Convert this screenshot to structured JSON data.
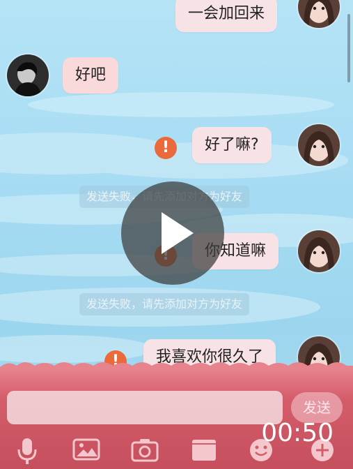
{
  "messages": [
    {
      "text": "一会加回来"
    },
    {
      "text": "好吧"
    },
    {
      "text": "好了嘛?"
    },
    {
      "text": "你知道嘛"
    },
    {
      "text": "我喜欢你很久了"
    }
  ],
  "notices": [
    {
      "text": "发送失败，请先添加对方为好友"
    },
    {
      "text": "发送失败，请先添加对方为好友"
    }
  ],
  "input_bar": {
    "placeholder": "",
    "send_label": "发送"
  },
  "video": {
    "time": "00:50"
  },
  "toolbar": [
    "microphone-icon",
    "image-icon",
    "camera-icon",
    "folder-icon",
    "emoji-icon",
    "plus-icon"
  ],
  "colors": {
    "bubble": "#f7e3e5",
    "fail_icon": "#ea6a3b",
    "input_bar": "#d45d6a"
  }
}
